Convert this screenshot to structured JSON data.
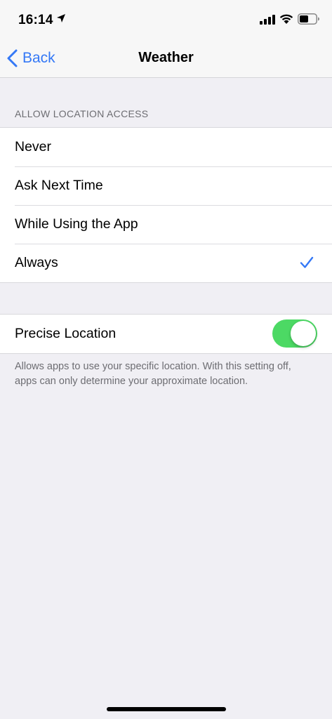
{
  "status_bar": {
    "time": "16:14",
    "icons": [
      "location-arrow-icon",
      "cellular-signal-icon",
      "wifi-icon",
      "battery-icon"
    ]
  },
  "nav": {
    "back_label": "Back",
    "title": "Weather"
  },
  "location_access": {
    "header": "ALLOW LOCATION ACCESS",
    "options": [
      {
        "label": "Never",
        "selected": false
      },
      {
        "label": "Ask Next Time",
        "selected": false
      },
      {
        "label": "While Using the App",
        "selected": false
      },
      {
        "label": "Always",
        "selected": true
      }
    ]
  },
  "precise_location": {
    "label": "Precise Location",
    "enabled": true,
    "footer": "Allows apps to use your specific location. With this setting off, apps can only determine your approximate location."
  },
  "colors": {
    "accent": "#3478f6",
    "toggle_on": "#4cd964",
    "background": "#f0eff4"
  }
}
